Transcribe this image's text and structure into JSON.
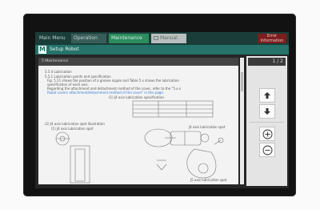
{
  "menu": {
    "main_menu": "Main Menu",
    "operation": "Operation",
    "maintenance": "Maintenance",
    "manual": "Manual",
    "error_info": "Error Information"
  },
  "title": {
    "icon_label": "M",
    "text": "Setup Robot"
  },
  "document": {
    "header": "5 Maintenance",
    "section": "5.5.4 Lubrication",
    "lines": [
      "5.5.1 Lubrication points and specification",
      "Fig. 5.11 shows the position of a grease nipple and Table 5.x shows the lubrication",
      "specification of each axis.",
      "Regarding the attachment and detachment method of the cover, refer to the \"5.x.x",
      "Robot covers attachment/detachment method of the cover\" in this page.",
      "(1) J4 axis lubrication specification",
      "(2) J4 axis lubrication spot illustration",
      "(1) J4 axis lubrication spot",
      "J4 axis lubrication spot",
      "J5 axis lubrication spot"
    ]
  },
  "page_indicator": "1 / 2",
  "icons": {
    "up": "arrow-up-icon",
    "down": "arrow-down-icon",
    "zoom_in": "zoom-in-icon",
    "zoom_out": "zoom-out-icon"
  },
  "colors": {
    "menu_bg": "#1a3d39",
    "title_bg": "#25736a",
    "maintenance_tab": "#2c8d5e",
    "error_tab": "#7e1d1d"
  }
}
